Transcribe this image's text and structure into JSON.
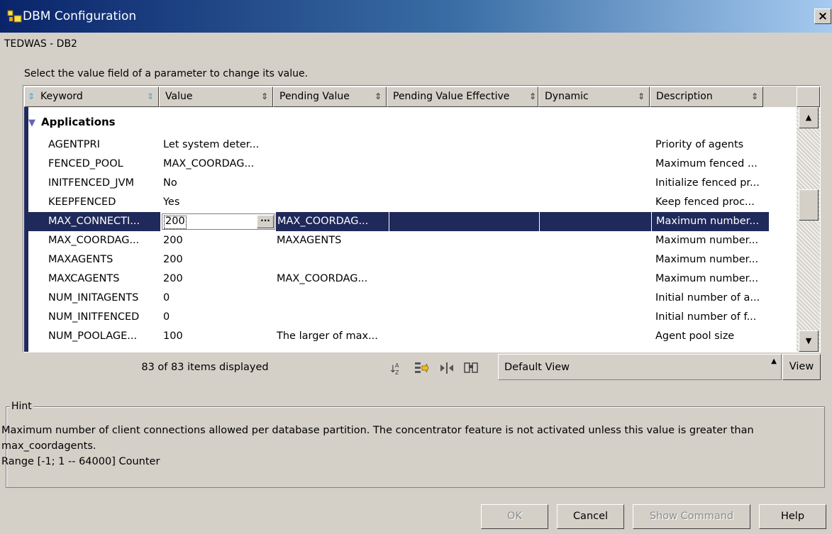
{
  "window": {
    "title": "DBM Configuration",
    "close_label": "×",
    "subtitle": "TEDWAS - DB2"
  },
  "instruction": "Select the value field of a parameter to change its value.",
  "columns": [
    "Keyword",
    "Value",
    "Pending Value",
    "Pending Value Effective",
    "Dynamic",
    "Description"
  ],
  "group": {
    "label": "Applications"
  },
  "rows": [
    {
      "keyword": "AGENTPRI",
      "value": "Let system deter...",
      "pending": "",
      "effective": "",
      "dynamic": "",
      "description": "Priority of agents"
    },
    {
      "keyword": "FENCED_POOL",
      "value": "MAX_COORDAG...",
      "pending": "",
      "effective": "",
      "dynamic": "",
      "description": "Maximum fenced ..."
    },
    {
      "keyword": "INITFENCED_JVM",
      "value": "No",
      "pending": "",
      "effective": "",
      "dynamic": "",
      "description": "Initialize fenced pr..."
    },
    {
      "keyword": "KEEPFENCED",
      "value": "Yes",
      "pending": "",
      "effective": "",
      "dynamic": "",
      "description": "Keep fenced proc..."
    },
    {
      "keyword": "MAX_CONNECTI...",
      "value": "200",
      "pending": "MAX_COORDAG...",
      "effective": "",
      "dynamic": "",
      "description": "Maximum number..."
    },
    {
      "keyword": "MAX_COORDAG...",
      "value": "200",
      "pending": "MAXAGENTS",
      "effective": "",
      "dynamic": "",
      "description": "Maximum number..."
    },
    {
      "keyword": "MAXAGENTS",
      "value": "200",
      "pending": "",
      "effective": "",
      "dynamic": "",
      "description": "Maximum number..."
    },
    {
      "keyword": "MAXCAGENTS",
      "value": "200",
      "pending": "MAX_COORDAG...",
      "effective": "",
      "dynamic": "",
      "description": "Maximum number..."
    },
    {
      "keyword": "NUM_INITAGENTS",
      "value": "0",
      "pending": "",
      "effective": "",
      "dynamic": "",
      "description": "Initial number of a..."
    },
    {
      "keyword": "NUM_INITFENCED",
      "value": "0",
      "pending": "",
      "effective": "",
      "dynamic": "",
      "description": "Initial number of f..."
    },
    {
      "keyword": "NUM_POOLAGE...",
      "value": "100",
      "pending": "The larger of max...",
      "effective": "",
      "dynamic": "",
      "description": "Agent pool size"
    }
  ],
  "edit_button_label": "···",
  "status": {
    "items_count": "83 of 83 items displayed",
    "view_name": "Default View",
    "view_button": "View"
  },
  "hint": {
    "label": "Hint",
    "line1": "Maximum number of client connections allowed per database partition.  The concentrator feature is not activated unless this value is greater than",
    "line2": "max_coordagents.",
    "line3": "Range [-1; 1 -- 64000] Counter"
  },
  "buttons": {
    "ok": "OK",
    "cancel": "Cancel",
    "show_command": "Show Command",
    "help": "Help"
  },
  "icons": [
    "sort-az-icon",
    "filter-icon",
    "column-icon",
    "find-icon"
  ]
}
